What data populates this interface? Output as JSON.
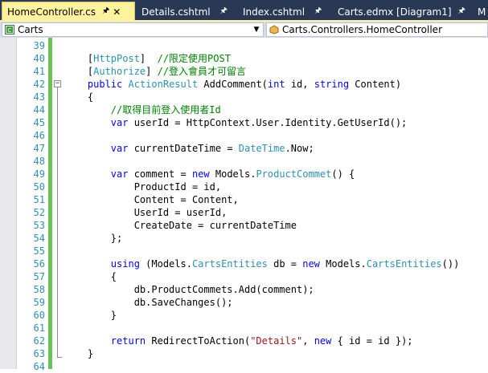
{
  "tabs": [
    {
      "label": "HomeController.cs",
      "active": true
    },
    {
      "label": "Details.cshtml",
      "active": false
    },
    {
      "label": "Index.cshtml",
      "active": false
    },
    {
      "label": "Carts.edmx [Diagram1]",
      "active": false
    },
    {
      "label": "M",
      "active": false
    }
  ],
  "nav": {
    "project": "Carts",
    "member": "Carts.Controllers.HomeController"
  },
  "colors": {
    "keyword": "#0000ff",
    "type": "#2b91af",
    "comment": "#008000",
    "string": "#a31515",
    "change_bar": "#6ac259",
    "active_tab": "#fff29d",
    "tab_bar": "#293955"
  },
  "code_lines": [
    {
      "n": "39",
      "tokens": []
    },
    {
      "n": "40",
      "tokens": [
        {
          "t": "    [",
          "c": ""
        },
        {
          "t": "HttpPost",
          "c": "ty"
        },
        {
          "t": "]  ",
          "c": ""
        },
        {
          "t": "//限定使用POST",
          "c": "cm"
        }
      ]
    },
    {
      "n": "41",
      "tokens": [
        {
          "t": "    [",
          "c": ""
        },
        {
          "t": "Authorize",
          "c": "ty"
        },
        {
          "t": "] ",
          "c": ""
        },
        {
          "t": "//登入會員才可留言",
          "c": "cm"
        }
      ]
    },
    {
      "n": "42",
      "tokens": [
        {
          "t": "    ",
          "c": ""
        },
        {
          "t": "public",
          "c": "kw"
        },
        {
          "t": " ",
          "c": ""
        },
        {
          "t": "ActionResult",
          "c": "ty"
        },
        {
          "t": " AddComment(",
          "c": ""
        },
        {
          "t": "int",
          "c": "kw"
        },
        {
          "t": " id, ",
          "c": ""
        },
        {
          "t": "string",
          "c": "kw"
        },
        {
          "t": " Content)",
          "c": ""
        }
      ]
    },
    {
      "n": "43",
      "tokens": [
        {
          "t": "    {",
          "c": ""
        }
      ]
    },
    {
      "n": "44",
      "tokens": [
        {
          "t": "        ",
          "c": ""
        },
        {
          "t": "//取得目前登入使用者Id",
          "c": "cm"
        }
      ]
    },
    {
      "n": "45",
      "tokens": [
        {
          "t": "        ",
          "c": ""
        },
        {
          "t": "var",
          "c": "kw"
        },
        {
          "t": " userId = HttpContext.User.Identity.GetUserId();",
          "c": ""
        }
      ]
    },
    {
      "n": "46",
      "tokens": []
    },
    {
      "n": "47",
      "tokens": [
        {
          "t": "        ",
          "c": ""
        },
        {
          "t": "var",
          "c": "kw"
        },
        {
          "t": " currentDateTime = ",
          "c": ""
        },
        {
          "t": "DateTime",
          "c": "ty"
        },
        {
          "t": ".Now;",
          "c": ""
        }
      ]
    },
    {
      "n": "48",
      "tokens": []
    },
    {
      "n": "49",
      "tokens": [
        {
          "t": "        ",
          "c": ""
        },
        {
          "t": "var",
          "c": "kw"
        },
        {
          "t": " comment = ",
          "c": ""
        },
        {
          "t": "new",
          "c": "kw"
        },
        {
          "t": " Models.",
          "c": ""
        },
        {
          "t": "ProductCommet",
          "c": "ty"
        },
        {
          "t": "() {",
          "c": ""
        }
      ]
    },
    {
      "n": "50",
      "tokens": [
        {
          "t": "            ProductId = id,",
          "c": ""
        }
      ]
    },
    {
      "n": "51",
      "tokens": [
        {
          "t": "            Content = Content,",
          "c": ""
        }
      ]
    },
    {
      "n": "52",
      "tokens": [
        {
          "t": "            UserId = userId,",
          "c": ""
        }
      ]
    },
    {
      "n": "53",
      "tokens": [
        {
          "t": "            CreateDate = currentDateTime",
          "c": ""
        }
      ]
    },
    {
      "n": "54",
      "tokens": [
        {
          "t": "        };",
          "c": ""
        }
      ]
    },
    {
      "n": "55",
      "tokens": []
    },
    {
      "n": "56",
      "tokens": [
        {
          "t": "        ",
          "c": ""
        },
        {
          "t": "using",
          "c": "kw"
        },
        {
          "t": " (Models.",
          "c": ""
        },
        {
          "t": "CartsEntities",
          "c": "ty"
        },
        {
          "t": " db = ",
          "c": ""
        },
        {
          "t": "new",
          "c": "kw"
        },
        {
          "t": " Models.",
          "c": ""
        },
        {
          "t": "CartsEntities",
          "c": "ty"
        },
        {
          "t": "())",
          "c": ""
        }
      ]
    },
    {
      "n": "57",
      "tokens": [
        {
          "t": "        {",
          "c": ""
        }
      ]
    },
    {
      "n": "58",
      "tokens": [
        {
          "t": "            db.ProductCommets.Add(comment);",
          "c": ""
        }
      ]
    },
    {
      "n": "59",
      "tokens": [
        {
          "t": "            db.SaveChanges();",
          "c": ""
        }
      ]
    },
    {
      "n": "60",
      "tokens": [
        {
          "t": "        }",
          "c": ""
        }
      ]
    },
    {
      "n": "61",
      "tokens": []
    },
    {
      "n": "62",
      "tokens": [
        {
          "t": "        ",
          "c": ""
        },
        {
          "t": "return",
          "c": "kw"
        },
        {
          "t": " RedirectToAction(",
          "c": ""
        },
        {
          "t": "\"Details\"",
          "c": "st"
        },
        {
          "t": ", ",
          "c": ""
        },
        {
          "t": "new",
          "c": "kw"
        },
        {
          "t": " { id = id });",
          "c": ""
        }
      ]
    },
    {
      "n": "63",
      "tokens": [
        {
          "t": "    }",
          "c": ""
        }
      ]
    },
    {
      "n": "64",
      "tokens": []
    }
  ]
}
